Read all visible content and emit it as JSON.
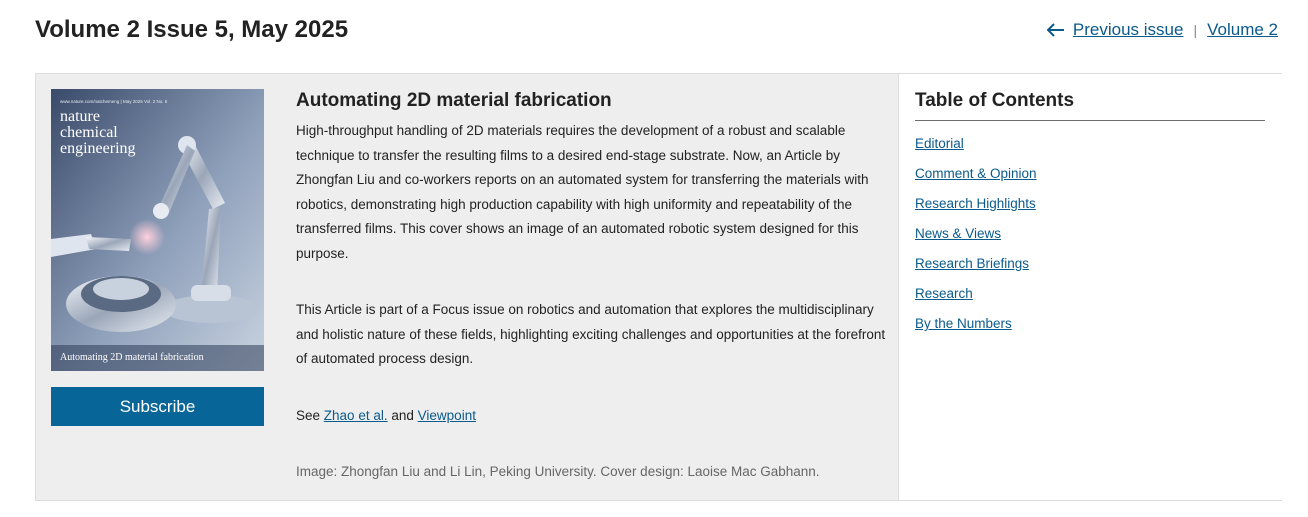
{
  "header": {
    "title": "Volume 2 Issue 5, May 2025",
    "previous_issue": "Previous issue",
    "separator": "|",
    "volume_link": "Volume 2"
  },
  "cover": {
    "journal_url": "www.nature.com/natchemeng | May 2025 Vol. 2 No. 5",
    "journal_name_line1": "nature",
    "journal_name_line2": "chemical",
    "journal_name_line3": "engineering",
    "caption": "Automating 2D material fabrication"
  },
  "subscribe_label": "Subscribe",
  "article": {
    "title": "Automating 2D material fabrication",
    "paragraph1": "High-throughput handling of 2D materials requires the development of a robust and scalable technique to transfer the resulting films to a desired end-stage substrate. Now, an Article by Zhongfan Liu and co-workers reports on an automated system for transferring the materials with robotics, demonstrating high production capability with high uniformity and repeatability of the transferred films. This cover shows an image of an automated robotic system designed for this purpose.",
    "paragraph2": "This Article is part of a Focus issue on robotics and automation that explores the multidisciplinary and holistic nature of these fields, highlighting exciting challenges and opportunities at the forefront of automated process design.",
    "see_prefix": "See",
    "see_link1": "Zhao et al.",
    "see_and": "and",
    "see_link2": "Viewpoint",
    "credit": "Image: Zhongfan Liu and Li Lin, Peking University. Cover design: Laoise Mac Gabhann."
  },
  "toc": {
    "title": "Table of Contents",
    "items": [
      {
        "label": "Editorial"
      },
      {
        "label": "Comment & Opinion"
      },
      {
        "label": "Research Highlights"
      },
      {
        "label": "News & Views"
      },
      {
        "label": "Research Briefings"
      },
      {
        "label": "Research"
      },
      {
        "label": "By the Numbers"
      }
    ]
  },
  "colors": {
    "link": "#0a5a8c",
    "subscribe_bg": "#086598",
    "panel_bg": "#eeeeee"
  }
}
